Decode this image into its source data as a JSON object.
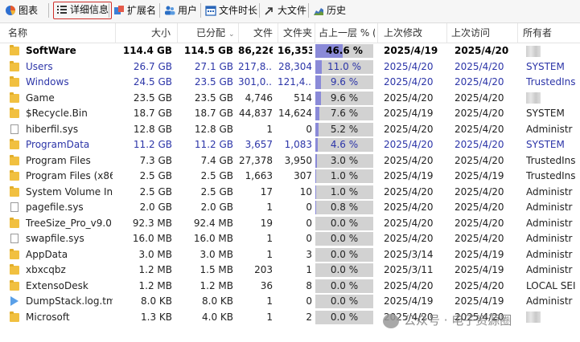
{
  "toolbar": {
    "items": [
      {
        "label": "图表",
        "icon": "pie-chart-icon"
      },
      {
        "label": "详细信息",
        "icon": "details-list-icon",
        "active": true
      },
      {
        "label": "扩展名",
        "icon": "extension-icon"
      },
      {
        "label": "用户",
        "icon": "users-icon"
      },
      {
        "label": "文件时长",
        "icon": "calendar-icon"
      },
      {
        "label": "大文件",
        "icon": "arrow-icon"
      },
      {
        "label": "历史",
        "icon": "history-chart-icon"
      }
    ],
    "active_border_color": "#d0302b"
  },
  "header": {
    "name": "名称",
    "size": "大小",
    "allocated": "已分配",
    "files": "文件",
    "folders": "文件夹",
    "percent": "占上一层 % (...",
    "modified": "上次修改",
    "accessed": "上次访问",
    "owner": "所有者"
  },
  "colors": {
    "compressed_text": "#2c35a8",
    "percent_fill": "#8a8ad8",
    "percent_bg": "#d2d2d2",
    "folder": "#f1c040"
  },
  "rows": [
    {
      "name": "SoftWare",
      "icon": "folder",
      "size": "114.4 GB",
      "alloc": "114.5 GB",
      "files": "86,226",
      "folders": "16,353",
      "pct": "46.6 %",
      "pct_value": 46.6,
      "modified": "2025/4/19",
      "accessed": "2025/4/20",
      "owner": "",
      "first": true
    },
    {
      "name": "Users",
      "icon": "folder",
      "size": "26.7 GB",
      "alloc": "27.1 GB",
      "files": "217,8...",
      "folders": "28,304",
      "pct": "11.0 %",
      "pct_value": 11.0,
      "modified": "2025/4/20",
      "accessed": "2025/4/20",
      "owner": "SYSTEM",
      "compressed": true
    },
    {
      "name": "Windows",
      "icon": "folder",
      "size": "24.5 GB",
      "alloc": "23.5 GB",
      "files": "301,0...",
      "folders": "121,4...",
      "pct": "9.6 %",
      "pct_value": 9.6,
      "modified": "2025/4/20",
      "accessed": "2025/4/20",
      "owner": "TrustedIns",
      "compressed": true
    },
    {
      "name": "Game",
      "icon": "folder",
      "size": "23.5 GB",
      "alloc": "23.5 GB",
      "files": "4,746",
      "folders": "514",
      "pct": "9.6 %",
      "pct_value": 9.6,
      "modified": "2025/4/20",
      "accessed": "2025/4/20",
      "owner": ""
    },
    {
      "name": "$Recycle.Bin",
      "icon": "folder",
      "size": "18.7 GB",
      "alloc": "18.7 GB",
      "files": "44,837",
      "folders": "14,624",
      "pct": "7.6 %",
      "pct_value": 7.6,
      "modified": "2025/4/19",
      "accessed": "2025/4/20",
      "owner": "SYSTEM"
    },
    {
      "name": "hiberfil.sys",
      "icon": "file",
      "size": "12.8 GB",
      "alloc": "12.8 GB",
      "files": "1",
      "folders": "0",
      "pct": "5.2 %",
      "pct_value": 5.2,
      "modified": "2025/4/20",
      "accessed": "2025/4/20",
      "owner": "Administr"
    },
    {
      "name": "ProgramData",
      "icon": "folder",
      "size": "11.2 GB",
      "alloc": "11.2 GB",
      "files": "3,657",
      "folders": "1,083",
      "pct": "4.6 %",
      "pct_value": 4.6,
      "modified": "2025/4/20",
      "accessed": "2025/4/20",
      "owner": "SYSTEM",
      "compressed": true
    },
    {
      "name": "Program Files",
      "icon": "folder",
      "size": "7.3 GB",
      "alloc": "7.4 GB",
      "files": "27,378",
      "folders": "3,950",
      "pct": "3.0 %",
      "pct_value": 3.0,
      "modified": "2025/4/20",
      "accessed": "2025/4/20",
      "owner": "TrustedIns"
    },
    {
      "name": "Program Files (x86)",
      "icon": "folder",
      "size": "2.5 GB",
      "alloc": "2.5 GB",
      "files": "1,663",
      "folders": "307",
      "pct": "1.0 %",
      "pct_value": 1.0,
      "modified": "2025/4/19",
      "accessed": "2025/4/19",
      "owner": "TrustedIns"
    },
    {
      "name": "System Volume Inf...",
      "icon": "folder",
      "size": "2.5 GB",
      "alloc": "2.5 GB",
      "files": "17",
      "folders": "10",
      "pct": "1.0 %",
      "pct_value": 1.0,
      "modified": "2025/4/20",
      "accessed": "2025/4/20",
      "owner": "Administr"
    },
    {
      "name": "pagefile.sys",
      "icon": "file",
      "size": "2.0 GB",
      "alloc": "2.0 GB",
      "files": "1",
      "folders": "0",
      "pct": "0.8 %",
      "pct_value": 0.8,
      "modified": "2025/4/20",
      "accessed": "2025/4/20",
      "owner": "Administr"
    },
    {
      "name": "TreeSize_Pro_v9.0....",
      "icon": "folder",
      "size": "92.3 MB",
      "alloc": "92.4 MB",
      "files": "19",
      "folders": "0",
      "pct": "0.0 %",
      "pct_value": 0.0,
      "modified": "2025/4/20",
      "accessed": "2025/4/20",
      "owner": "Administr"
    },
    {
      "name": "swapfile.sys",
      "icon": "file",
      "size": "16.0 MB",
      "alloc": "16.0 MB",
      "files": "1",
      "folders": "0",
      "pct": "0.0 %",
      "pct_value": 0.0,
      "modified": "2025/4/20",
      "accessed": "2025/4/20",
      "owner": "Administr"
    },
    {
      "name": "AppData",
      "icon": "folder",
      "size": "3.0 MB",
      "alloc": "3.0 MB",
      "files": "1",
      "folders": "3",
      "pct": "0.0 %",
      "pct_value": 0.0,
      "modified": "2025/3/14",
      "accessed": "2025/4/19",
      "owner": "Administr"
    },
    {
      "name": "xbxcqbz",
      "icon": "folder",
      "size": "1.2 MB",
      "alloc": "1.5 MB",
      "files": "203",
      "folders": "1",
      "pct": "0.0 %",
      "pct_value": 0.0,
      "modified": "2025/3/11",
      "accessed": "2025/4/19",
      "owner": "Administr"
    },
    {
      "name": "ExtensoDesk",
      "icon": "folder",
      "size": "1.2 MB",
      "alloc": "1.2 MB",
      "files": "36",
      "folders": "8",
      "pct": "0.0 %",
      "pct_value": 0.0,
      "modified": "2025/4/20",
      "accessed": "2025/4/20",
      "owner": "LOCAL SEI"
    },
    {
      "name": "DumpStack.log.tmp",
      "icon": "play",
      "size": "8.0 KB",
      "alloc": "8.0 KB",
      "files": "1",
      "folders": "0",
      "pct": "0.0 %",
      "pct_value": 0.0,
      "modified": "2025/4/19",
      "accessed": "2025/4/19",
      "owner": "Administr"
    },
    {
      "name": "Microsoft",
      "icon": "folder",
      "size": "1.3 KB",
      "alloc": "4.0 KB",
      "files": "1",
      "folders": "2",
      "pct": "0.0 %",
      "pct_value": 0.0,
      "modified": "2025/4/20",
      "accessed": "2025/4/20",
      "owner": ""
    }
  ],
  "watermark": "公众号 · 电子资源圈"
}
